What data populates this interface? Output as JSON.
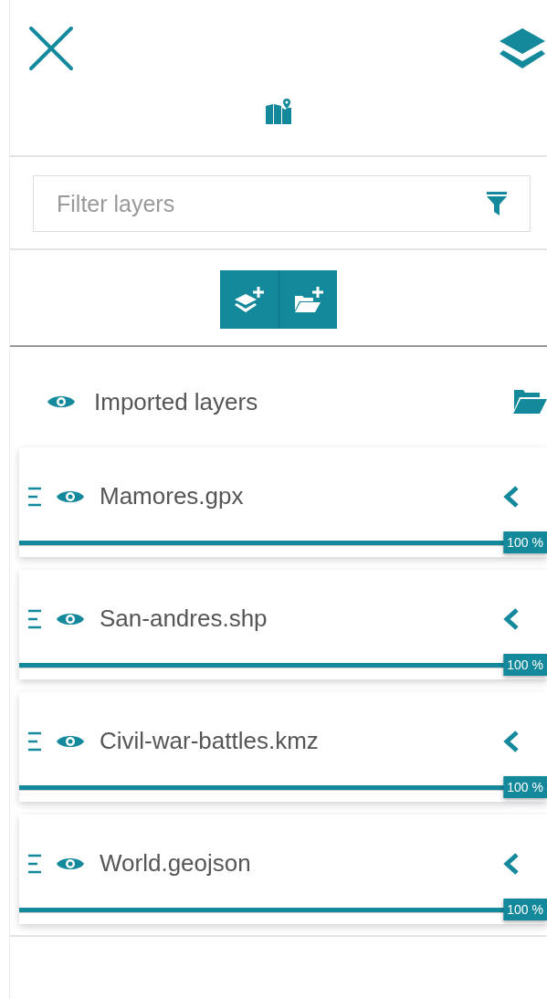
{
  "filter": {
    "placeholder": "Filter layers"
  },
  "group": {
    "label": "Imported layers",
    "visible": true
  },
  "layers": [
    {
      "name": "Mamores.gpx",
      "visible": true,
      "level": 1,
      "reading": "100 %"
    },
    {
      "name": "San-andres.shp",
      "visible": true,
      "level": 1,
      "reading": "100 %"
    },
    {
      "name": "Civil-war-battles.kmz",
      "visible": true,
      "level": 1,
      "reading": "100 %"
    },
    {
      "name": "World.geojson",
      "visible": true,
      "level": 1,
      "reading": "100 %"
    }
  ]
}
